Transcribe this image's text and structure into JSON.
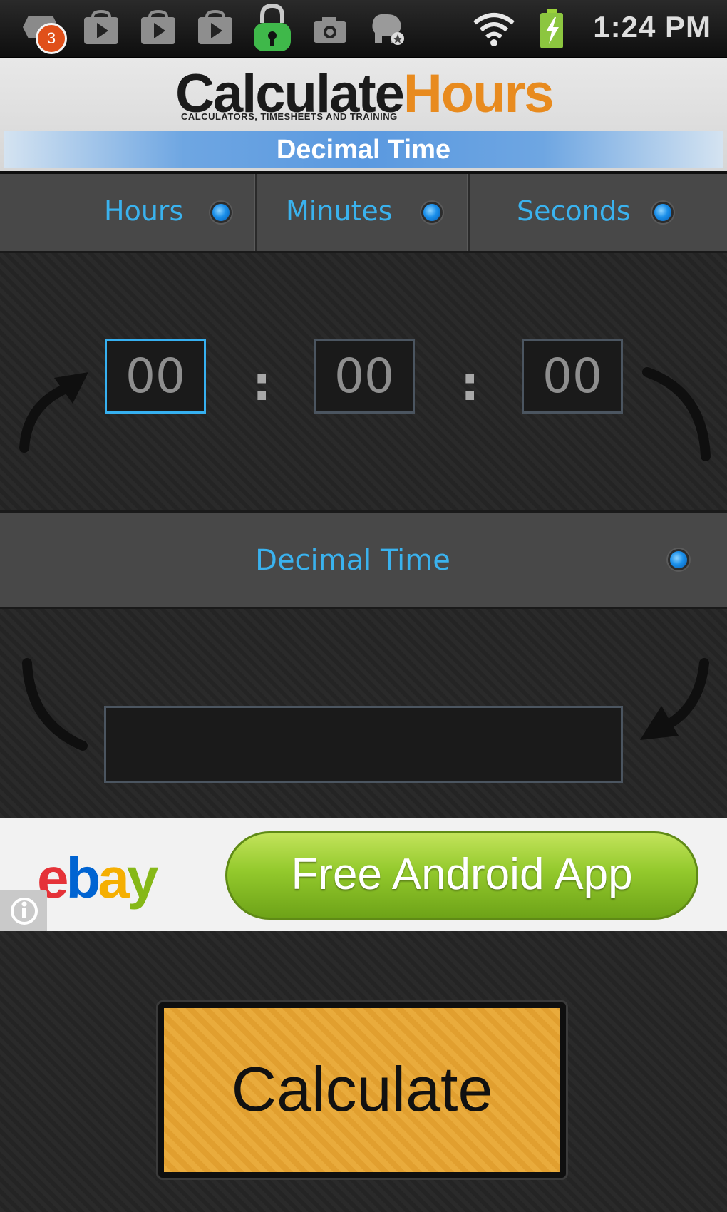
{
  "status_bar": {
    "notification_count": "3",
    "time": "1:24 PM",
    "icons": [
      "notification-bubble-icon",
      "play-store-icon",
      "play-store-icon",
      "play-store-icon",
      "lock-icon",
      "camera-icon",
      "dog-icon",
      "wifi-icon",
      "battery-charging-icon"
    ]
  },
  "header": {
    "logo_part1": "Calculate",
    "logo_part2": "Hours",
    "tagline": "CALCULATORS, TIMESHEETS AND TRAINING",
    "title": "Decimal Time"
  },
  "tabs": [
    {
      "label": "Hours"
    },
    {
      "label": "Minutes"
    },
    {
      "label": "Seconds"
    }
  ],
  "time_inputs": {
    "hours": "00",
    "minutes": "00",
    "seconds": "00",
    "separator": ":"
  },
  "decimal_section": {
    "label": "Decimal Time",
    "result_value": ""
  },
  "ad": {
    "brand_e": "e",
    "brand_b": "b",
    "brand_a": "a",
    "brand_y": "y",
    "cta": "Free Android App"
  },
  "calculate_button": {
    "label": "Calculate"
  },
  "colors": {
    "accent_blue": "#3ab2ee",
    "button_orange": "#e9ab3c",
    "logo_orange": "#e88b1f"
  }
}
